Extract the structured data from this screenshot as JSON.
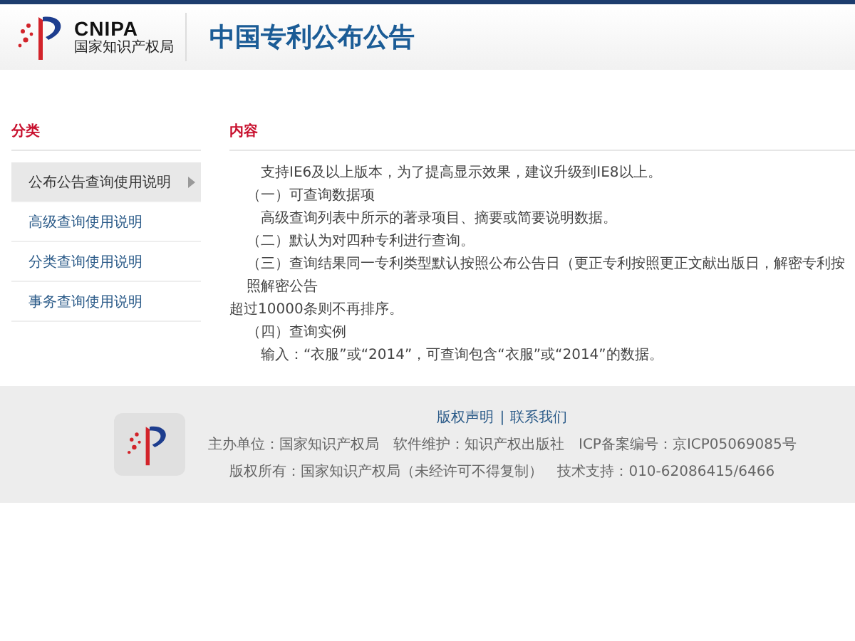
{
  "header": {
    "logo_text": "CNIPA",
    "logo_subtitle": "国家知识产权局",
    "title": "中国专利公布公告"
  },
  "sidebar": {
    "heading": "分类",
    "items": [
      {
        "label": "公布公告查询使用说明",
        "selected": true
      },
      {
        "label": "高级查询使用说明",
        "selected": false
      },
      {
        "label": "分类查询使用说明",
        "selected": false
      },
      {
        "label": "事务查询使用说明",
        "selected": false
      }
    ]
  },
  "content": {
    "heading": "内容",
    "paragraphs": [
      {
        "text": "支持IE6及以上版本，为了提高显示效果，建议升级到IE8以上。",
        "kind": "paragraph"
      },
      {
        "text": "（一）可查询数据项",
        "kind": "item"
      },
      {
        "text": "高级查询列表中所示的著录项目、摘要或简要说明数据。",
        "kind": "paragraph"
      },
      {
        "text": "（二）默认为对四种专利进行查询。",
        "kind": "item"
      },
      {
        "text": "（三）查询结果同一专利类型默认按照公布公告日（更正专利按照更正文献出版日，解密专利按照解密公告",
        "kind": "item"
      },
      {
        "text": "超过10000条则不再排序。",
        "kind": "continuation"
      },
      {
        "text": "（四）查询实例",
        "kind": "item"
      },
      {
        "text": "输入：“衣服”或“2014”，可查询包含“衣服”或“2014”的数据。",
        "kind": "paragraph"
      }
    ]
  },
  "footer": {
    "links": [
      "版权声明",
      "联系我们"
    ],
    "separator": "|",
    "lines": [
      [
        "主办单位：国家知识产权局",
        "软件维护：知识产权出版社",
        "ICP备案编号：京ICP05069085号"
      ],
      [
        "版权所有：国家知识产权局（未经许可不得复制）",
        "技术支持：010-62086415/6466"
      ]
    ]
  }
}
